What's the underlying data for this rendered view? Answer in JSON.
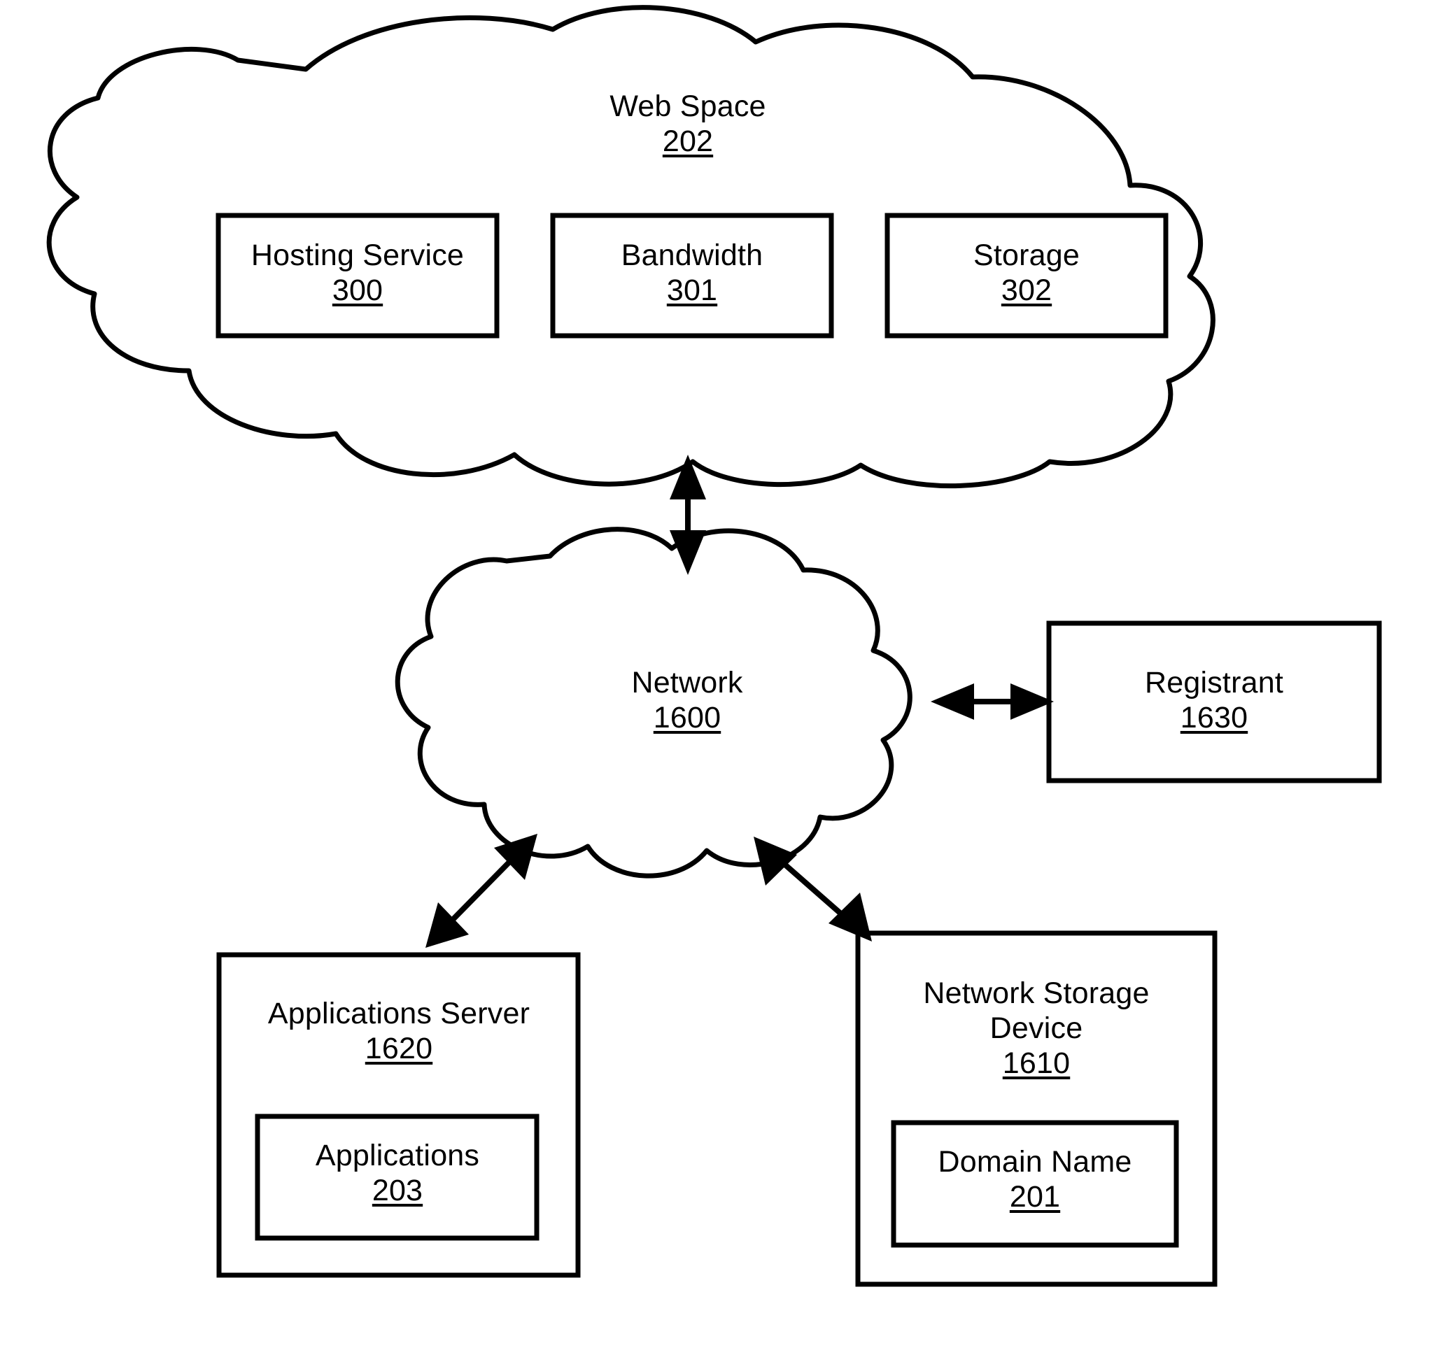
{
  "figure": {
    "type": "patent-block-diagram",
    "background_color": "#ffffff",
    "line_color": "#000000"
  },
  "nodes": {
    "web_space": {
      "label": "Web Space",
      "ref": "202",
      "shape": "cloud"
    },
    "hosting_service": {
      "label": "Hosting Service",
      "ref": "300",
      "shape": "rect"
    },
    "bandwidth": {
      "label": "Bandwidth",
      "ref": "301",
      "shape": "rect"
    },
    "storage": {
      "label": "Storage",
      "ref": "302",
      "shape": "rect"
    },
    "network": {
      "label": "Network",
      "ref": "1600",
      "shape": "cloud"
    },
    "registrant": {
      "label": "Registrant",
      "ref": "1630",
      "shape": "rect"
    },
    "applications_server": {
      "label": "Applications Server",
      "ref": "1620",
      "shape": "rect"
    },
    "applications": {
      "label": "Applications",
      "ref": "203",
      "shape": "rect"
    },
    "network_storage_device": {
      "label_line1": "Network Storage",
      "label_line2": "Device",
      "ref": "1610",
      "shape": "rect"
    },
    "domain_name": {
      "label": "Domain Name",
      "ref": "201",
      "shape": "rect"
    }
  },
  "connections": [
    {
      "name": "web-space-to-network",
      "from": "web_space",
      "to": "network",
      "style": "double-arrow"
    },
    {
      "name": "network-to-registrant",
      "from": "network",
      "to": "registrant",
      "style": "double-arrow"
    },
    {
      "name": "network-to-applications-server",
      "from": "network",
      "to": "applications_server",
      "style": "double-arrow"
    },
    {
      "name": "network-to-network-storage-device",
      "from": "network",
      "to": "network_storage_device",
      "style": "double-arrow"
    }
  ]
}
